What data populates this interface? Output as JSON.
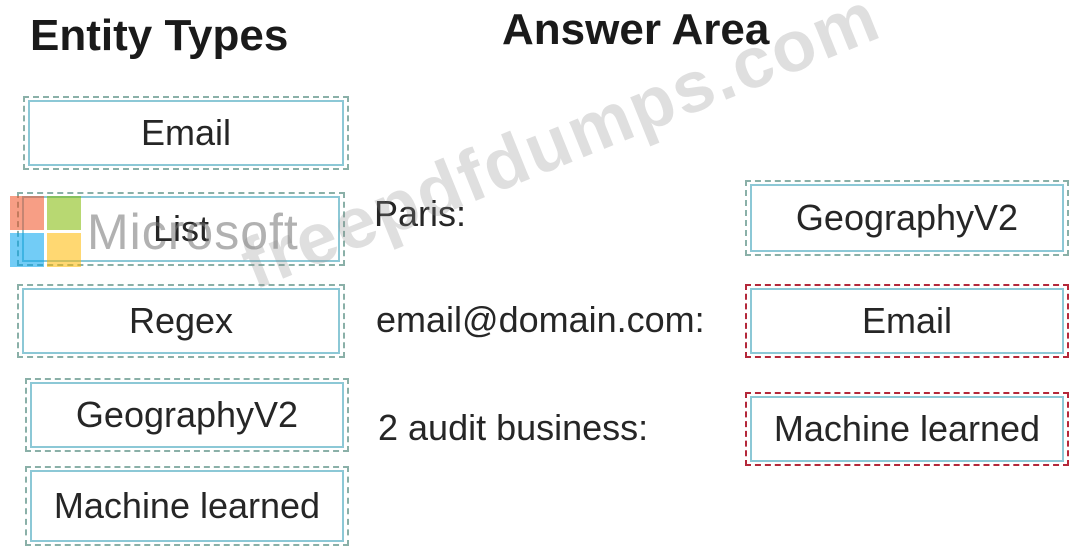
{
  "headings": {
    "entity_types": "Entity Types",
    "answer_area": "Answer Area"
  },
  "entity_types": [
    {
      "label": "Email"
    },
    {
      "label": "List"
    },
    {
      "label": "Regex"
    },
    {
      "label": "GeographyV2"
    },
    {
      "label": "Machine learned"
    }
  ],
  "answers": [
    {
      "prompt": "Paris:",
      "answer": "GeographyV2"
    },
    {
      "prompt": "email@domain.com:",
      "answer": "Email"
    },
    {
      "prompt": "2 audit business:",
      "answer": "Machine learned"
    }
  ],
  "logo": {
    "wordmark": "Microsoft"
  },
  "watermark": {
    "text": "freepdfdumps.com"
  },
  "colors": {
    "tile_border": "#8cc8d6",
    "dash_border": "#8ab0a8",
    "highlight_dash": "#b4283a"
  }
}
